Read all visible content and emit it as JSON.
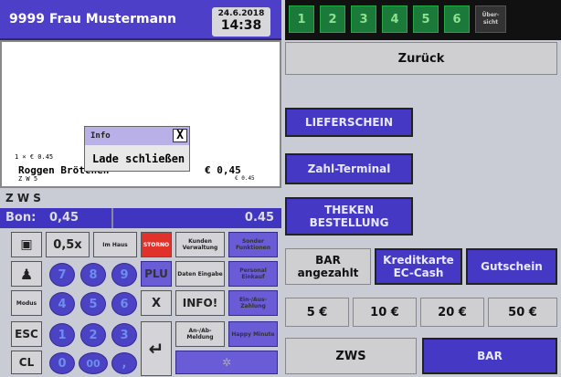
{
  "header": {
    "user": "9999  Frau Mustermann",
    "date": "24.6.2018",
    "time": "14:38"
  },
  "tabs": [
    "1",
    "2",
    "3",
    "4",
    "5",
    "6"
  ],
  "tab_overview": "Über- sicht",
  "receipt": {
    "line1": "1 × € 0.45",
    "item": "Roggen Brötchen",
    "item_value": "€ 0,45",
    "line3": "Z W 5",
    "line3_value": "€ 0.45"
  },
  "dialog": {
    "title": "Info",
    "close": "X",
    "message": "Lade schließen"
  },
  "zws_label": "Z W S",
  "bon": {
    "label": "Bon:",
    "value": "0,45",
    "total": "0.45"
  },
  "keys": {
    "calc_icon": "▣",
    "half": "0,5x",
    "im_haus": "Im Haus",
    "storno": "STORNO",
    "kunden": "Kunden Verwaltung",
    "sonder": "Sonder Funktionen",
    "d7": "7",
    "d8": "8",
    "d9": "9",
    "plu": "PLU",
    "daten": "Daten Eingabe",
    "personal": "Personal Einkauf",
    "modus": "Modus",
    "d4": "4",
    "d5": "5",
    "d6": "6",
    "x": "X",
    "info": "INFO!",
    "ein_aus": "Ein-/Aus- Zahlung",
    "esc": "ESC",
    "d1": "1",
    "d2": "2",
    "d3": "3",
    "enter": "↵",
    "an_ab": "An-/Ab- Meldung",
    "happy": "Happy Minute",
    "cl": "CL",
    "d0": "0",
    "d00": "00",
    "dot": ",",
    "person_icon": "♟",
    "bottom_icon": "✲"
  },
  "right": {
    "back": "Zurück",
    "lieferschein": "LIEFERSCHEIN",
    "zahl": "Zahl-Terminal",
    "theken": "THEKEN BESTELLUNG",
    "bar_angezahlt": "BAR angezahlt",
    "kredit": "Kreditkarte EC-Cash",
    "gutschein": "Gutschein",
    "e5": "5 €",
    "e10": "10 €",
    "e20": "20 €",
    "e50": "50 €",
    "zws": "ZWS",
    "bar": "BAR"
  }
}
